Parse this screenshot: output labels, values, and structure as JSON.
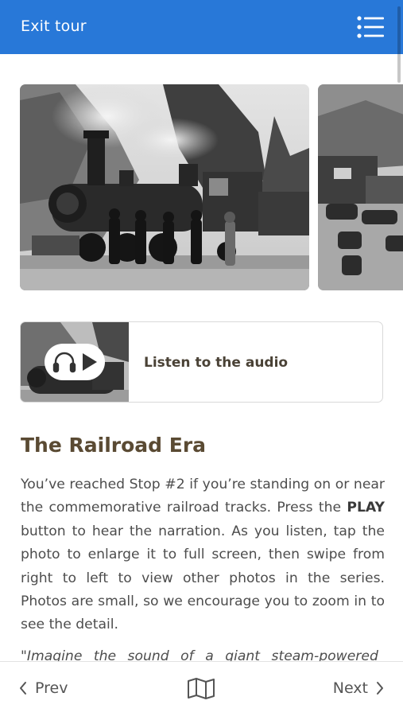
{
  "header": {
    "exit_label": "Exit tour",
    "menu_icon": "list-menu-icon",
    "background_color": "#2878d8"
  },
  "carousel": {
    "photos": [
      {
        "icon": "steam-locomotive-photo"
      },
      {
        "icon": "old-town-street-photo"
      }
    ]
  },
  "audio": {
    "label": "Listen to the audio",
    "icons": [
      "headphones-icon",
      "play-icon"
    ]
  },
  "article": {
    "title": "The Railroad Era",
    "body_part1": "You’ve reached Stop #2 if you’re standing on or near the commemorative railroad tracks. Press the ",
    "body_bold": "PLAY",
    "body_part2": " button to hear the narration. As you listen, tap the photo to enlarge it to full screen, then swipe from right to left to view other photos in the series. Photos are small, so we encourage you to zoom in to see the detail.",
    "quote": "\"Imagine the sound of a giant steam-powered"
  },
  "footer": {
    "prev_label": "Prev",
    "next_label": "Next",
    "map_icon": "map-icon"
  }
}
